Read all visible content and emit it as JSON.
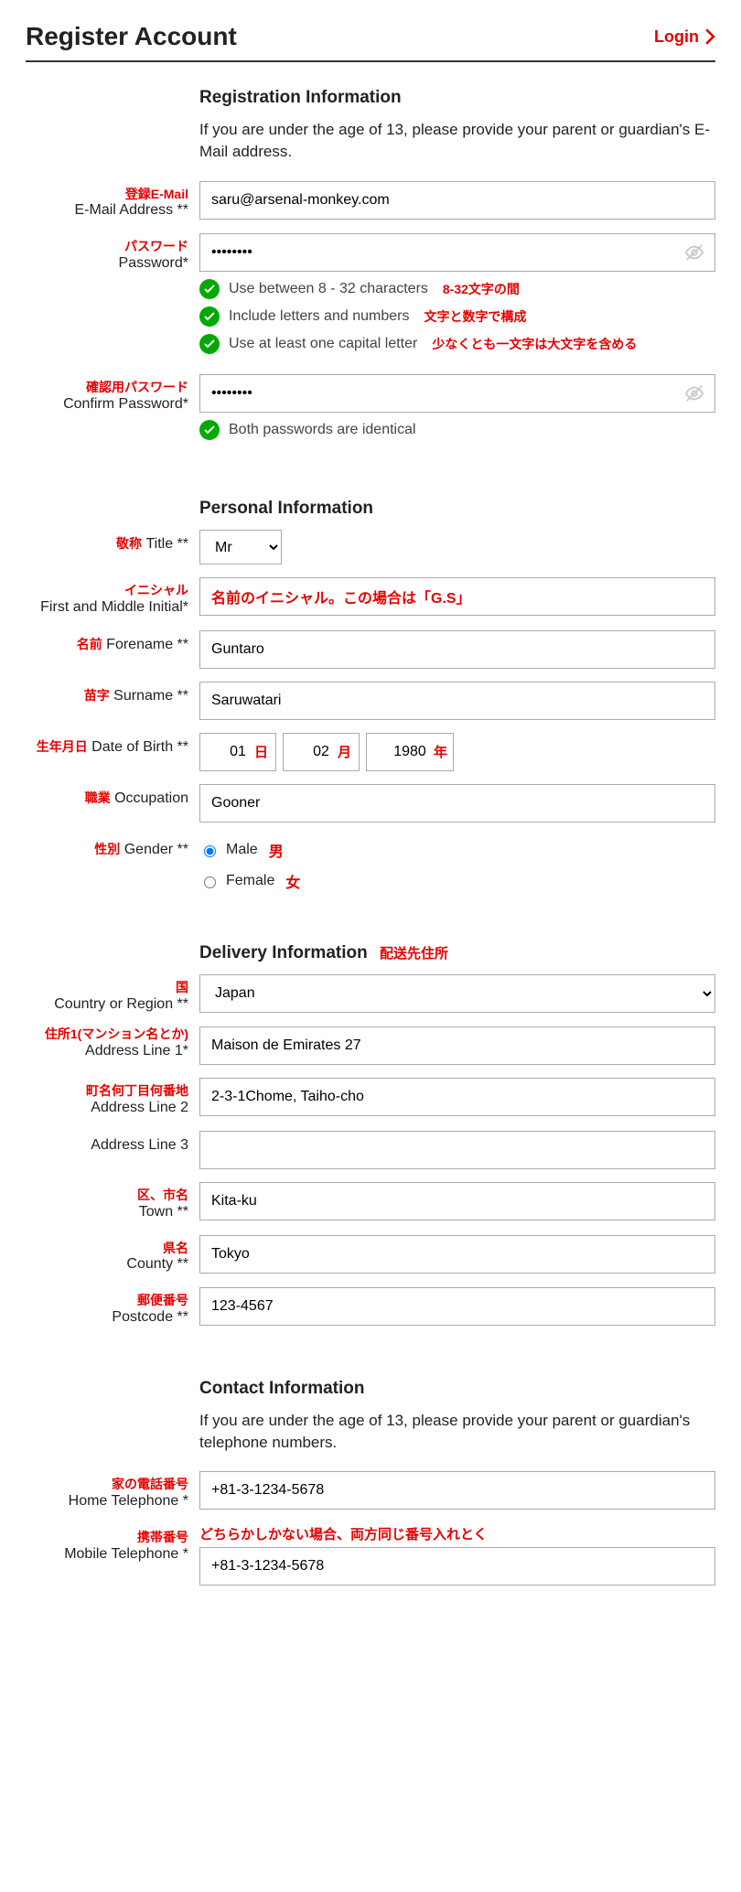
{
  "header": {
    "title": "Register Account",
    "login_label": "Login"
  },
  "sections": {
    "registration": {
      "title": "Registration Information",
      "note": "If you are under the age of 13, please provide your parent or guardian's E-Mail address."
    },
    "personal": {
      "title": "Personal Information"
    },
    "delivery": {
      "title": "Delivery Information",
      "jp": "配送先住所"
    },
    "contact": {
      "title": "Contact Information",
      "note": "If you are under the age of 13, please provide your parent or guardian's telephone numbers."
    }
  },
  "fields": {
    "email": {
      "jp": "登録E-Mail",
      "label": "E-Mail Address **",
      "value": "saru@arsenal-monkey.com"
    },
    "password": {
      "jp": "パスワード",
      "label": "Password*",
      "value": "••••••••"
    },
    "confirm_password": {
      "jp": "確認用パスワード",
      "label": "Confirm Password*",
      "value": "••••••••"
    },
    "title": {
      "jp": "敬称",
      "label": "Title **",
      "value": "Mr"
    },
    "initial": {
      "jp": "イニシャル",
      "label": "First and Middle Initial*",
      "placeholder_jp": "名前のイニシャル。この場合は「G.S」"
    },
    "forename": {
      "jp": "名前",
      "label": "Forename **",
      "value": "Guntaro"
    },
    "surname": {
      "jp": "苗字",
      "label": "Surname **",
      "value": "Saruwatari"
    },
    "dob": {
      "jp": "生年月日",
      "label": "Date of Birth **",
      "day": "01",
      "day_jp": "日",
      "month": "02",
      "month_jp": "月",
      "year": "1980",
      "year_jp": "年"
    },
    "occupation": {
      "jp": "職業",
      "label": "Occupation",
      "value": "Gooner"
    },
    "gender": {
      "jp": "性別",
      "label": "Gender **",
      "male": "Male",
      "male_jp": "男",
      "female": "Female",
      "female_jp": "女"
    },
    "country": {
      "jp": "国",
      "label": "Country or Region **",
      "value": "Japan"
    },
    "addr1": {
      "jp": "住所1(マンション名とか)",
      "label": "Address Line 1*",
      "value": "Maison de Emirates 27"
    },
    "addr2": {
      "jp": "町名何丁目何番地",
      "label": "Address Line 2",
      "value": "2-3-1Chome, Taiho-cho"
    },
    "addr3": {
      "label": "Address Line 3",
      "value": ""
    },
    "town": {
      "jp": "区、市名",
      "label": "Town **",
      "value": "Kita-ku"
    },
    "county": {
      "jp": "県名",
      "label": "County **",
      "value": "Tokyo"
    },
    "postcode": {
      "jp": "郵便番号",
      "label": "Postcode **",
      "value": "123-4567"
    },
    "home_tel": {
      "jp": "家の電話番号",
      "label": "Home Telephone *",
      "value": "+81-3-1234-5678"
    },
    "mobile_tel": {
      "jp": "携帯番号",
      "label": "Mobile Telephone *",
      "value": "+81-3-1234-5678",
      "note_jp": "どちらかしかない場合、両方同じ番号入れとく"
    }
  },
  "password_rules": {
    "r1": {
      "text": "Use between 8 - 32 characters",
      "jp": "8-32文字の間"
    },
    "r2": {
      "text": "Include letters and numbers",
      "jp": "文字と数字で構成"
    },
    "r3": {
      "text": "Use at least one capital letter",
      "jp": "少なくとも一文字は大文字を含める"
    },
    "match": {
      "text": "Both passwords are identical"
    }
  }
}
